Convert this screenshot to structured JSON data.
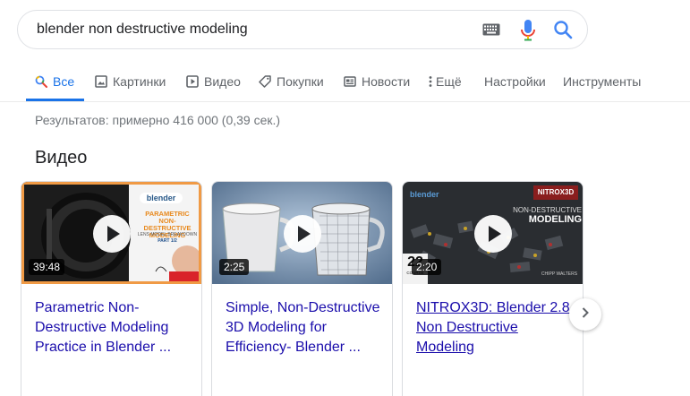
{
  "search": {
    "query": "blender non destructive modeling"
  },
  "tabs": [
    {
      "label": "Все",
      "active": true
    },
    {
      "label": "Картинки"
    },
    {
      "label": "Видео"
    },
    {
      "label": "Покупки"
    },
    {
      "label": "Новости"
    },
    {
      "label": "Ещё"
    },
    {
      "label": "Настройки"
    },
    {
      "label": "Инструменты"
    }
  ],
  "results_stats": "Результатов: примерно 416 000 (0,39 сек.)",
  "section_title": "Видео",
  "videos": [
    {
      "duration": "39:48",
      "title": "Parametric Non-Destructive Modeling Practice in Blender ...",
      "thumb_text": [
        "PARAMETRIC",
        "NON-DESTRUCTIVE",
        "MODELING",
        "LENS MODEL BREAKDOWN",
        "PART 1/2"
      ],
      "brand": "blender"
    },
    {
      "duration": "2:25",
      "title": "Simple, Non-Destructive 3D Modeling for Efficiency- Blender ..."
    },
    {
      "duration": "2:20",
      "title": "NITROX3D: Blender 2.8 Non Destructive Modeling",
      "thumb_text": [
        "NITROX3D",
        "NON-DESTRUCTIVE",
        "MODELING",
        "22",
        "COURSE",
        "CHIPP WALTERS"
      ],
      "brand": "blender"
    }
  ],
  "colors": {
    "accent": "#1a73e8",
    "link": "#1a0dab",
    "selected_outline": "#f09a45"
  }
}
